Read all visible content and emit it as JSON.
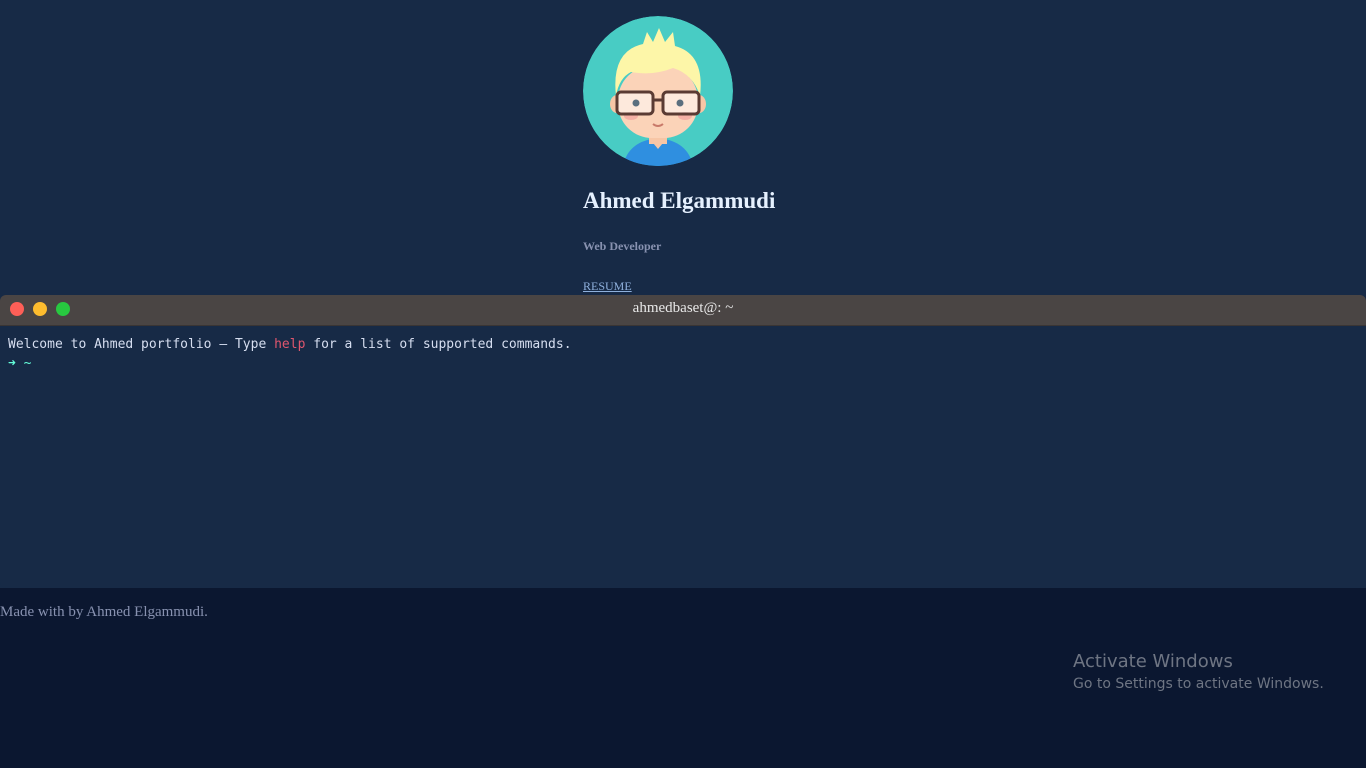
{
  "profile": {
    "avatar_icon": "cartoon-avatar-glasses",
    "name": "Ahmed Elgammudi",
    "role": "Web Developer",
    "resume_link": "RESUME"
  },
  "terminal": {
    "title": "ahmedbaset@: ~",
    "welcome_prefix": "Welcome to Ahmed portfolio — Type ",
    "welcome_command": "help",
    "welcome_suffix": " for a list of supported commands.",
    "prompt_arrow": "➜",
    "prompt_path": "~",
    "colors": {
      "close": "#fe5f57",
      "minimize": "#febc2e",
      "maximize": "#28c840",
      "command": "#e0566e",
      "prompt": "#64ffda"
    }
  },
  "footer": {
    "text": "Made with by Ahmed Elgammudi."
  },
  "watermark": {
    "title": "Activate Windows",
    "subtitle": "Go to Settings to activate Windows."
  }
}
